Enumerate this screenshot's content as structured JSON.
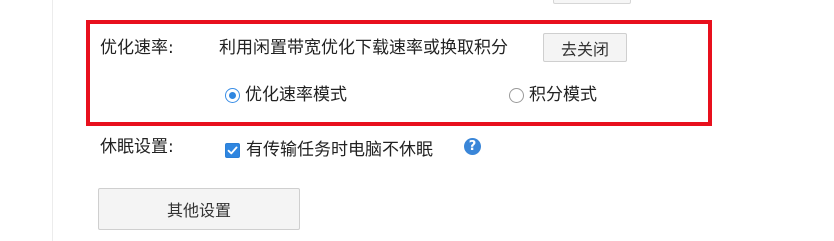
{
  "speed_optimization": {
    "label": "优化速率:",
    "description": "利用闲置带宽优化下载速率或换取积分",
    "close_button": "去关闭",
    "mode_options": [
      {
        "label": "优化速率模式",
        "selected": true
      },
      {
        "label": "积分模式",
        "selected": false
      }
    ]
  },
  "sleep_settings": {
    "label": "休眠设置:",
    "checkbox_label": "有传输任务时电脑不休眠",
    "checked": true,
    "help_icon": "question-circle-icon"
  },
  "other_settings_button": "其他设置",
  "colors": {
    "highlight": "#e8101d",
    "accent": "#2f86e0"
  }
}
